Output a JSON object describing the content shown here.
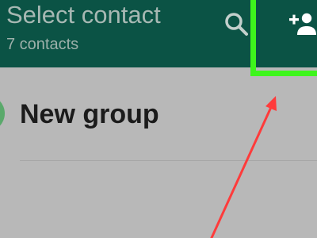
{
  "app_bar": {
    "title": "Select contact",
    "subtitle": "7 contacts",
    "search_icon": "search-icon",
    "add_contact_icon": "add-contact-icon",
    "color": "#0b5345"
  },
  "list": {
    "new_group_label": "New group",
    "new_group_icon": "group-avatar-icon"
  },
  "highlight": {
    "color": "#3ef51c"
  },
  "annotation": {
    "arrow_color": "#ff3b3b"
  }
}
